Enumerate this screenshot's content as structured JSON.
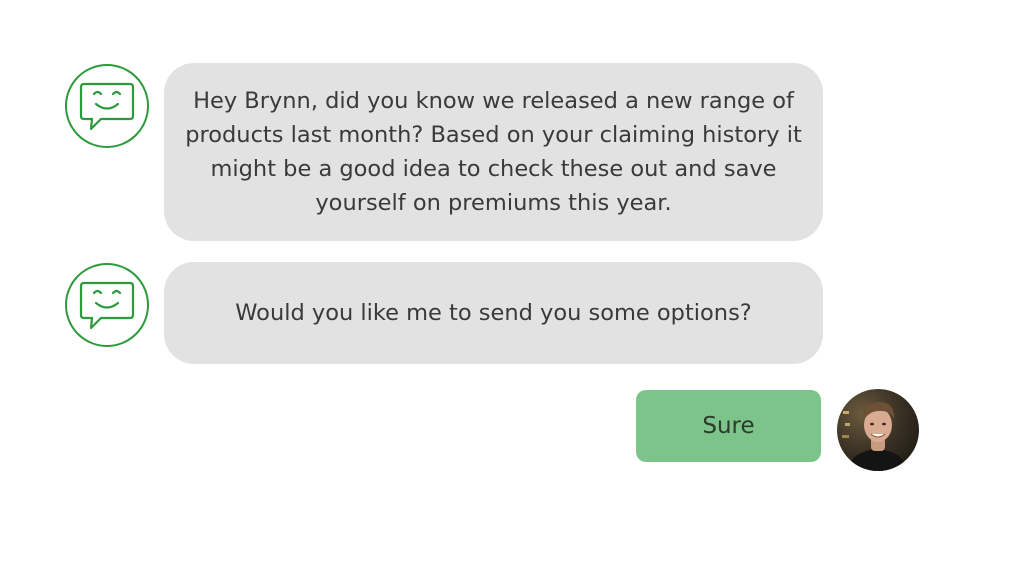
{
  "conversation": {
    "messages": [
      {
        "sender": "bot",
        "avatar_icon": "smiley-chat-icon",
        "text": "Hey Brynn, did you know we released a new range of products last month? Based on your claiming history it might be a good idea to check these out and save yourself on premiums this year."
      },
      {
        "sender": "bot",
        "avatar_icon": "smiley-chat-icon",
        "text": "Would you like me to send you some options?"
      }
    ],
    "reply": {
      "sender": "user",
      "text": "Sure"
    }
  },
  "colors": {
    "bot_accent": "#2e9a3e",
    "bot_bubble": "#e2e2e2",
    "user_bubble": "#7dc48a"
  }
}
